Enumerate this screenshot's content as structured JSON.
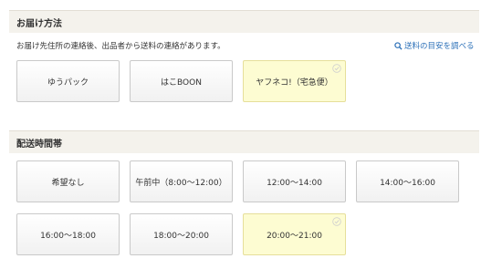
{
  "shipping": {
    "title": "お届け方法",
    "note": "お届け先住所の連絡後、出品者から送料の連絡があります。",
    "estimate_link": "送料の目安を調べる",
    "options": [
      {
        "label": "ゆうパック",
        "selected": false
      },
      {
        "label": "はこBOON",
        "selected": false
      },
      {
        "label": "ヤフネコ!（宅急便）",
        "selected": true
      }
    ]
  },
  "delivery_time": {
    "title": "配送時間帯",
    "options": [
      {
        "label": "希望なし",
        "selected": false
      },
      {
        "label": "午前中（8:00〜12:00）",
        "selected": false
      },
      {
        "label": "12:00〜14:00",
        "selected": false
      },
      {
        "label": "14:00〜16:00",
        "selected": false
      },
      {
        "label": "16:00〜18:00",
        "selected": false
      },
      {
        "label": "18:00〜20:00",
        "selected": false
      },
      {
        "label": "20:00〜21:00",
        "selected": true
      }
    ]
  },
  "colors": {
    "selected_bg": "#fdfcd2",
    "header_bg": "#f4f2ec",
    "link": "#2a6fb7"
  }
}
